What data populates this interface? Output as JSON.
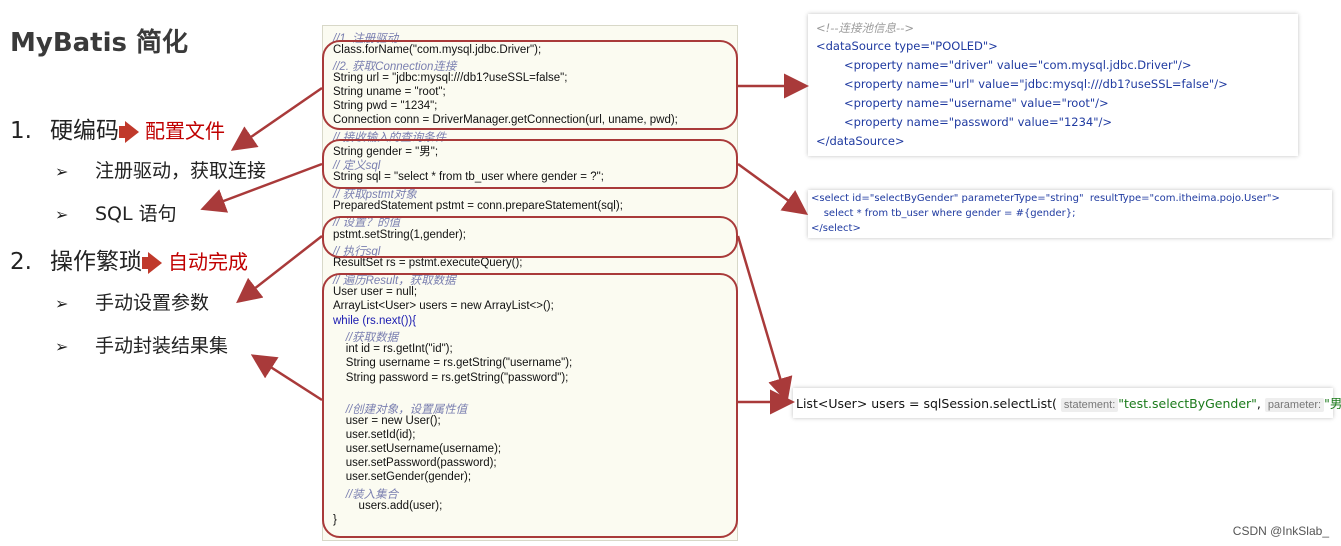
{
  "title": "MyBatis 简化",
  "items": [
    {
      "num": "1.",
      "label": "硬编码",
      "result": "配置文件",
      "subs": [
        "注册驱动，获取连接",
        "SQL 语句"
      ]
    },
    {
      "num": "2.",
      "label": "操作繁琐",
      "result": "自动完成",
      "subs": [
        "手动设置参数",
        "手动封装结果集"
      ]
    }
  ],
  "bullet": "➢",
  "code": [
    "//1. 注册驱动",
    "Class.forName(\"com.mysql.jdbc.Driver\");",
    "//2. 获取Connection连接",
    "String url = \"jdbc:mysql:///db1?useSSL=false\";",
    "String uname = \"root\";",
    "String pwd = \"1234\";",
    "Connection conn = DriverManager.getConnection(url, uname, pwd);",
    "// 接收输入的查询条件",
    "String gender = \"男\";",
    "// 定义sql",
    "String sql = \"select * from tb_user where gender = ?\";",
    "// 获取pstmt对象",
    "PreparedStatement pstmt = conn.prepareStatement(sql);",
    "// 设置？的值",
    "pstmt.setString(1,gender);",
    "// 执行sql",
    "ResultSet rs = pstmt.executeQuery();",
    "// 遍历Result，获取数据",
    "User user = null;",
    "ArrayList<User> users = new ArrayList<>();",
    "while (rs.next()){",
    "    //获取数据",
    "    int id = rs.getInt(\"id\");",
    "    String username = rs.getString(\"username\");",
    "    String password = rs.getString(\"password\");",
    "",
    "    //创建对象，设置属性值",
    "    user = new User();",
    "    user.setId(id);",
    "    user.setUsername(username);",
    "    user.setPassword(password);",
    "    user.setGender(gender);",
    "    //装入集合",
    "        users.add(user);",
    "}"
  ],
  "xml_datasource": {
    "comment": "<!--连接池信息-->",
    "open": "<dataSource type=\"POOLED\">",
    "properties": [
      "<property name=\"driver\" value=\"com.mysql.jdbc.Driver\"/>",
      "<property name=\"url\" value=\"jdbc:mysql:///db1?useSSL=false\"/>",
      "<property name=\"username\" value=\"root\"/>",
      "<property name=\"password\" value=\"1234\"/>"
    ],
    "close": "</dataSource>"
  },
  "xml_select": {
    "open": "<select id=\"selectByGender\" parameterType=\"string\"  resultType=\"com.itheima.pojo.User\">",
    "body": "    select * from tb_user where gender = #{gender};",
    "close": "</select>"
  },
  "java_call": {
    "prefix": "List<User> users = sqlSession.selectList(",
    "hint1": "statement:",
    "arg1": "\"test.selectByGender\"",
    "sep": ",",
    "hint2": "parameter:",
    "arg2": "\"男\"",
    "suffix": ");"
  },
  "watermark": "CSDN @InkSlab_",
  "colors": {
    "accent_red": "#c00000",
    "arrow": "#a93a3a"
  }
}
